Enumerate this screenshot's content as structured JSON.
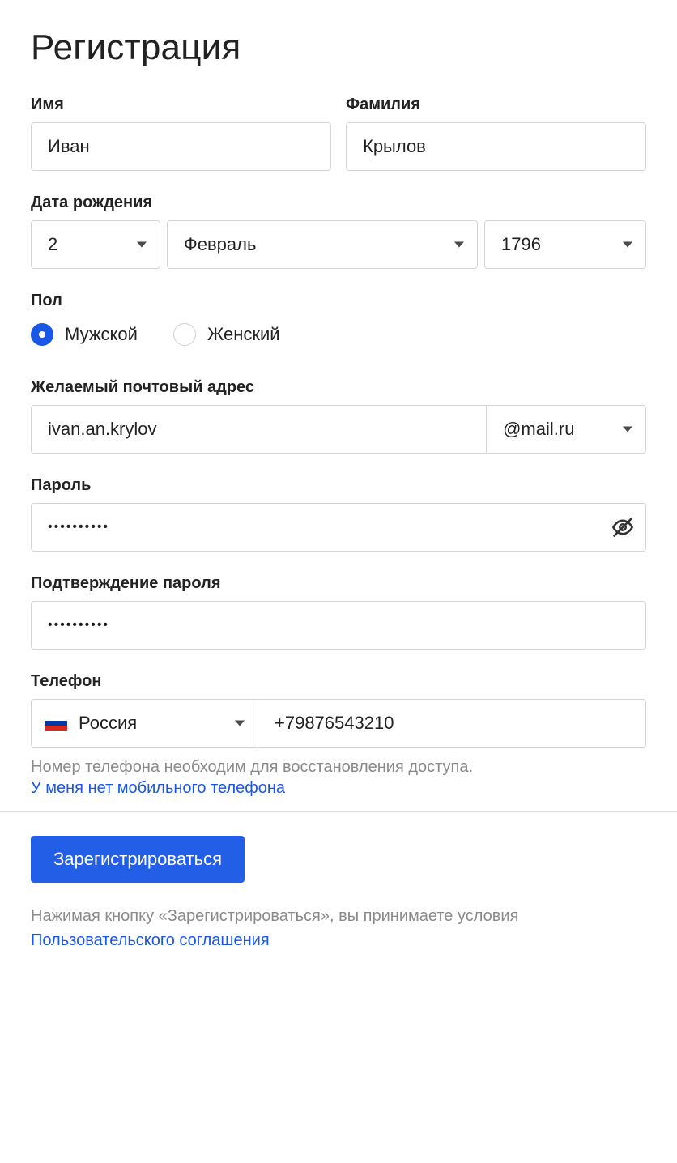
{
  "title": "Регистрация",
  "name": {
    "first_label": "Имя",
    "first_value": "Иван",
    "last_label": "Фамилия",
    "last_value": "Крылов"
  },
  "dob": {
    "label": "Дата рождения",
    "day": "2",
    "month": "Февраль",
    "year": "1796"
  },
  "gender": {
    "label": "Пол",
    "male": "Мужской",
    "female": "Женский",
    "selected": "male"
  },
  "email": {
    "label": "Желаемый почтовый адрес",
    "value": "ivan.an.krylov",
    "domain": "@mail.ru"
  },
  "password": {
    "label": "Пароль",
    "value": "••••••••••"
  },
  "password_confirm": {
    "label": "Подтверждение пароля",
    "value": "••••••••••"
  },
  "phone": {
    "label": "Телефон",
    "country": "Россия",
    "value": "+79876543210",
    "hint": "Номер телефона необходим для восстановления доступа.",
    "no_phone_link": "У меня нет мобильного телефона"
  },
  "submit": "Зарегистрироваться",
  "terms": {
    "prefix": "Нажимая кнопку «Зарегистрироваться», вы принимаете условия ",
    "link": "Пользовательского соглашения"
  }
}
